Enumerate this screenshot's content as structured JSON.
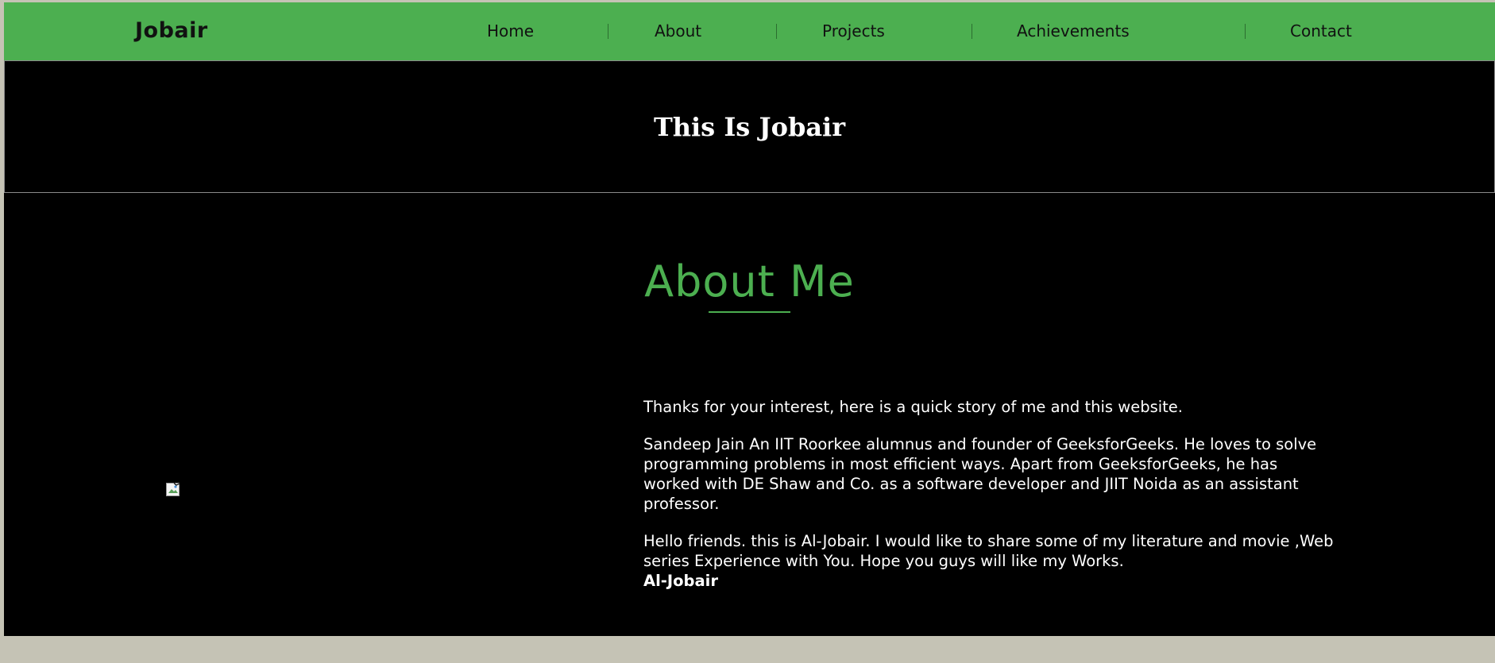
{
  "navbar": {
    "brand": "Jobair",
    "links": [
      "Home",
      "About",
      "Projects",
      "Achievements",
      "Contact"
    ]
  },
  "hero": {
    "title": "This Is Jobair"
  },
  "about": {
    "heading": "About Me",
    "paragraphs": [
      "Thanks for your interest, here is a quick story of me and this website.",
      "Sandeep Jain An IIT Roorkee alumnus and founder of GeeksforGeeks. He loves to solve programming problems in most efficient ways. Apart from GeeksforGeeks, he has worked with DE Shaw and Co. as a software developer and JIIT Noida as an assistant professor.",
      "Hello friends. this is Al-Jobair. I would like to share some of my literature and movie ,Web series Experience with You. Hope you guys will like my Works."
    ],
    "signature": "Al-Jobair"
  },
  "colors": {
    "accent": "#4caf50",
    "background": "#000000",
    "page_margin": "#c5c3b5"
  }
}
